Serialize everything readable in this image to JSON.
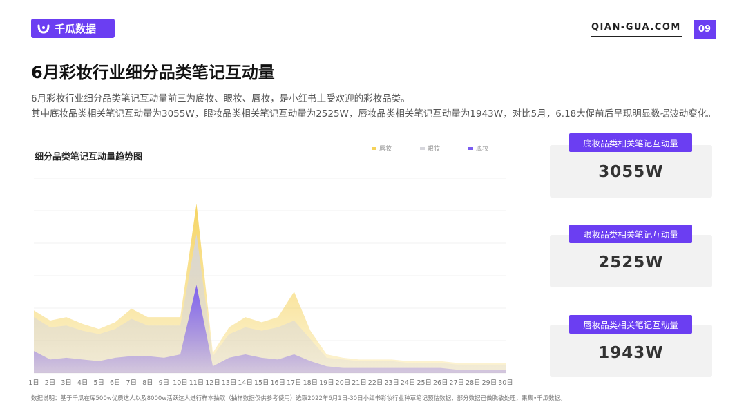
{
  "brand": {
    "name": "千瓜数据",
    "site": "QIAN-GUA.COM",
    "page_number": "09",
    "accent": "#6b3ef2"
  },
  "title": "6月彩妆行业细分品类笔记互动量",
  "description": [
    "6月彩妆行业细分品类笔记互动量前三为底妆、眼妆、唇妆，是小红书上受欢迎的彩妆品类。",
    "其中底妆品类相关笔记互动量为3055W，眼妆品类相关笔记互动量为2525W，唇妆品类相关笔记互动量为1943W，对比5月，6.18大促前后呈现明显数据波动变化。"
  ],
  "cards": [
    {
      "label": "底妆品类相关笔记互动量",
      "value": "3055W"
    },
    {
      "label": "眼妆品类相关笔记互动量",
      "value": "2525W"
    },
    {
      "label": "唇妆品类相关笔记互动量",
      "value": "1943W"
    }
  ],
  "footnote": "数据说明：基于千瓜在库500w优质达人以及8000w活跃达人进行样本抽取（抽样数据仅供参考使用）选取2022年6月1日-30日小红书彩妆行业种草笔记预估数据，部分数据已做脱敏处理，果集•千瓜数据。",
  "chart_data": {
    "type": "area",
    "title": "细分品类笔记互动量趋势图",
    "categories": [
      "1日",
      "2日",
      "3日",
      "4日",
      "5日",
      "6日",
      "7日",
      "8日",
      "9日",
      "10日",
      "11日",
      "12日",
      "13日",
      "14日",
      "15日",
      "16日",
      "17日",
      "18日",
      "19日",
      "20日",
      "21日",
      "22日",
      "23日",
      "24日",
      "25日",
      "26日",
      "27日",
      "28日",
      "29日",
      "30日"
    ],
    "series": [
      {
        "name": "唇妆",
        "color": "#f5d25a",
        "values": [
          37,
          31,
          33,
          29,
          26,
          30,
          38,
          33,
          33,
          33,
          100,
          12,
          27,
          33,
          30,
          33,
          48,
          25,
          11,
          9,
          8,
          8,
          8,
          7,
          7,
          7,
          6,
          6,
          6,
          6
        ]
      },
      {
        "name": "眼妆",
        "color": "#d6d6dc",
        "values": [
          33,
          27,
          28,
          25,
          23,
          26,
          32,
          28,
          28,
          28,
          82,
          10,
          23,
          27,
          25,
          27,
          31,
          20,
          9,
          8,
          7,
          7,
          7,
          6,
          6,
          6,
          5,
          5,
          5,
          5
        ]
      },
      {
        "name": "底妆",
        "color": "#7a5cf0",
        "values": [
          13,
          8,
          9,
          8,
          7,
          9,
          10,
          10,
          9,
          11,
          52,
          4,
          9,
          11,
          9,
          8,
          11,
          7,
          4,
          3,
          3,
          3,
          3,
          3,
          3,
          3,
          2,
          2,
          2,
          2
        ]
      }
    ],
    "ylim": [
      0,
      115
    ],
    "grid": true,
    "legend_position": "top-right"
  }
}
